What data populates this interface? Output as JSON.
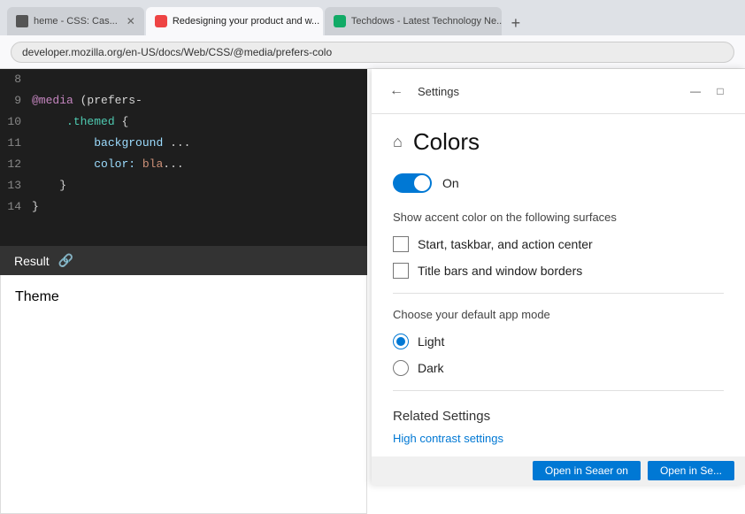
{
  "browser": {
    "tabs": [
      {
        "id": "tab1",
        "label": "heme - CSS: Cas...",
        "favicon_color": "#555",
        "active": false
      },
      {
        "id": "tab2",
        "label": "Redesigning your product and w...",
        "favicon_color": "#e44",
        "active": true
      },
      {
        "id": "tab3",
        "label": "Techdows - Latest Technology Ne...",
        "favicon_color": "#1a6",
        "active": false
      }
    ],
    "address": "developer.mozilla.org/en-US/docs/Web/CSS/@media/prefers-colo"
  },
  "code": {
    "lines": [
      {
        "num": "8",
        "content": ""
      },
      {
        "num": "9",
        "prefix_at": "@media (prefers-",
        "suffix": "..."
      },
      {
        "num": "10",
        "indent": "    ",
        "selector": ".themed",
        "brace": " {"
      },
      {
        "num": "11",
        "indent": "        ",
        "prop": "background",
        "suffix": "..."
      },
      {
        "num": "12",
        "indent": "        ",
        "prop": "color:",
        "value": " bla..."
      },
      {
        "num": "13",
        "indent": "    ",
        "brace_close": "}"
      },
      {
        "num": "14",
        "brace_close": "}"
      }
    ]
  },
  "result_bar": {
    "label": "Result",
    "link_icon": "🔗"
  },
  "theme_area": {
    "label": "Theme"
  },
  "settings": {
    "title": "Settings",
    "back_label": "←",
    "page_title": "Colors",
    "home_icon": "⌂",
    "win_min": "—",
    "win_max": "□",
    "toggle_label": "On",
    "accent_section_label": "Show accent color on the following surfaces",
    "checkbox1_label": "Start, taskbar, and action center",
    "checkbox2_label": "Title bars and window borders",
    "app_mode_label": "Choose your default app mode",
    "radio_light": "Light",
    "radio_dark": "Dark",
    "related_settings_title": "Related Settings",
    "high_contrast_link": "High contrast settings",
    "open_btn1": "Open in Seaer on",
    "open_btn2": "Open in Se..."
  }
}
